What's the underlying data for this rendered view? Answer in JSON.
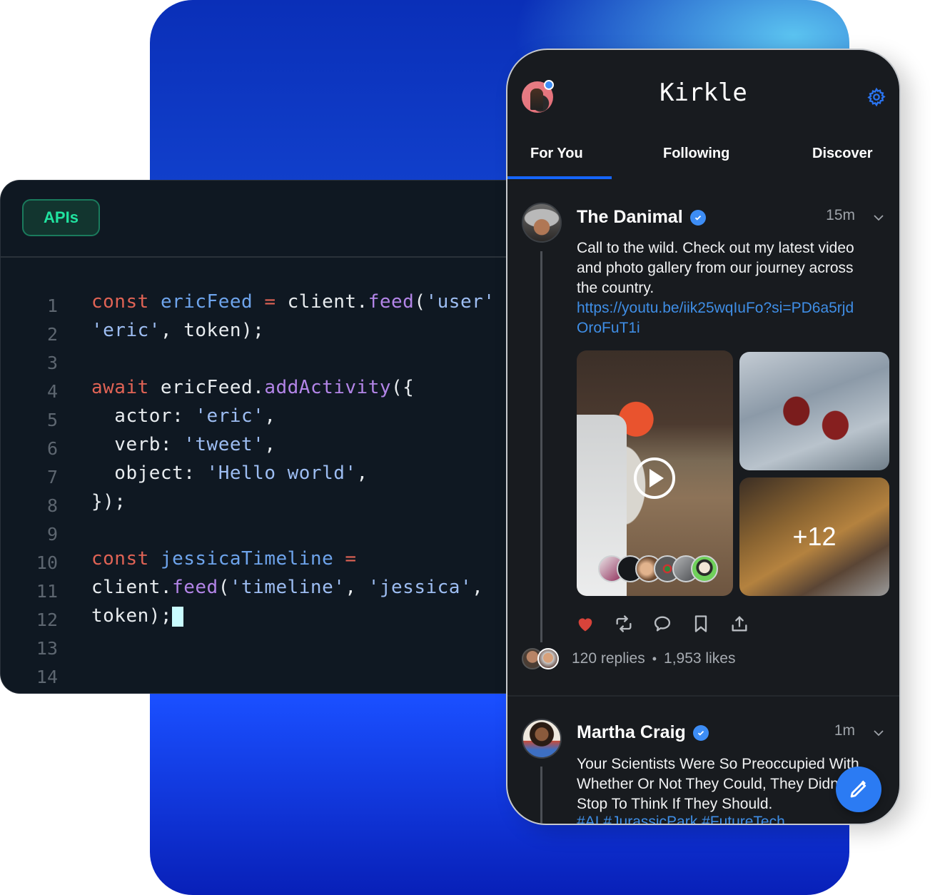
{
  "code_panel": {
    "tab_label": "APIs",
    "lines": [
      {
        "n": "1",
        "segments": [
          [
            "kw",
            "const"
          ],
          [
            "plain",
            " "
          ],
          [
            "var",
            "ericFeed"
          ],
          [
            "plain",
            " "
          ],
          [
            "kw",
            "="
          ],
          [
            "plain",
            " client."
          ],
          [
            "fn",
            "feed"
          ],
          [
            "plain",
            "("
          ],
          [
            "str",
            "'user'"
          ]
        ]
      },
      {
        "n": "2",
        "segments": [
          [
            "str",
            "'eric'"
          ],
          [
            "plain",
            ", token);"
          ]
        ]
      },
      {
        "n": "3",
        "segments": []
      },
      {
        "n": "4",
        "segments": [
          [
            "kw",
            "await"
          ],
          [
            "plain",
            " ericFeed."
          ],
          [
            "fn",
            "addActivity"
          ],
          [
            "plain",
            "({"
          ]
        ]
      },
      {
        "n": "5",
        "segments": [
          [
            "plain",
            "  actor: "
          ],
          [
            "str",
            "'eric'"
          ],
          [
            "plain",
            ","
          ]
        ]
      },
      {
        "n": "6",
        "segments": [
          [
            "plain",
            "  verb: "
          ],
          [
            "str",
            "'tweet'"
          ],
          [
            "plain",
            ","
          ]
        ]
      },
      {
        "n": "7",
        "segments": [
          [
            "plain",
            "  object: "
          ],
          [
            "str",
            "'Hello world'"
          ],
          [
            "plain",
            ","
          ]
        ]
      },
      {
        "n": "8",
        "segments": [
          [
            "plain",
            "});"
          ]
        ]
      },
      {
        "n": "9",
        "segments": []
      },
      {
        "n": "10",
        "segments": [
          [
            "kw",
            "const"
          ],
          [
            "plain",
            " "
          ],
          [
            "var",
            "jessicaTimeline"
          ],
          [
            "plain",
            " "
          ],
          [
            "kw",
            "="
          ]
        ]
      },
      {
        "n": "11",
        "segments": [
          [
            "plain",
            "client."
          ],
          [
            "fn",
            "feed"
          ],
          [
            "plain",
            "("
          ],
          [
            "str",
            "'timeline'"
          ],
          [
            "plain",
            ", "
          ],
          [
            "str",
            "'jessica'"
          ],
          [
            "plain",
            ","
          ]
        ]
      },
      {
        "n": "12",
        "segments": [
          [
            "plain",
            "token);"
          ]
        ],
        "cursor": true
      },
      {
        "n": "13",
        "segments": []
      },
      {
        "n": "14",
        "segments": []
      }
    ]
  },
  "app": {
    "title": "Kirkle",
    "tabs": [
      {
        "label": "For You",
        "active": true
      },
      {
        "label": "Following",
        "active": false
      },
      {
        "label": "Discover",
        "active": false
      }
    ],
    "accent_color": "#1565ff"
  },
  "posts": [
    {
      "author": "The Danimal",
      "verified": true,
      "time": "15m",
      "text": "Call to the wild. Check out my latest video and photo gallery from our journey across the country.",
      "link": "https://youtu.be/iik25wqIuFo?si=PD6a5rjdOroFuT1i",
      "media_more_count": "+12",
      "liked": true,
      "replies": "120 replies",
      "likes": "1,953 likes"
    },
    {
      "author": "Martha Craig",
      "verified": true,
      "time": "1m",
      "text": "Your Scientists Were So Preoccupied With Whether Or Not They Could, They Didn’t Stop To Think If They Should.",
      "hashtags": "#AI #JurassicPark #FutureTech"
    }
  ],
  "icons": {
    "settings": "gear-icon",
    "compose": "pencil-icon",
    "actions": [
      "heart-icon",
      "repost-icon",
      "comment-icon",
      "bookmark-icon",
      "share-icon"
    ]
  }
}
